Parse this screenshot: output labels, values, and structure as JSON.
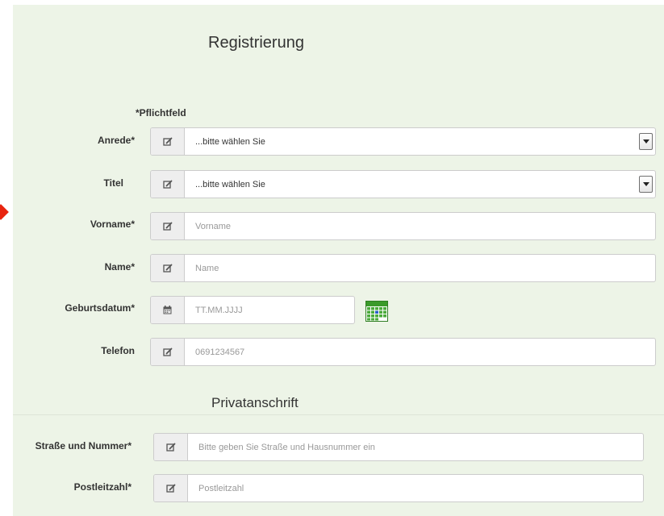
{
  "form": {
    "title": "Registrierung",
    "required_note": "*Pflichtfeld",
    "fields": {
      "anrede": {
        "label": "Anrede*",
        "value": "...bitte wählen Sie",
        "icon": "edit-icon"
      },
      "titel": {
        "label": "Titel",
        "value": "...bitte wählen Sie",
        "icon": "edit-icon"
      },
      "vorname": {
        "label": "Vorname*",
        "placeholder": "Vorname",
        "icon": "edit-icon"
      },
      "name": {
        "label": "Name*",
        "placeholder": "Name",
        "icon": "edit-icon"
      },
      "geburtsdatum": {
        "label": "Geburtsdatum*",
        "placeholder": "TT.MM.JJJJ",
        "icon": "calendar-icon"
      },
      "telefon": {
        "label": "Telefon",
        "placeholder": "0691234567",
        "icon": "edit-icon"
      }
    }
  },
  "address": {
    "title": "Privatanschrift",
    "fields": {
      "strasse": {
        "label": "Straße und Nummer*",
        "placeholder": "Bitte geben Sie Straße und Hausnummer ein",
        "icon": "edit-icon"
      },
      "plz": {
        "label": "Postleitzahl*",
        "placeholder": "Postleitzahl",
        "icon": "edit-icon"
      }
    }
  },
  "colors": {
    "panel_background": "#edf4e7",
    "marker": "#e8240f",
    "calendar_green": "#3a9a2a"
  }
}
